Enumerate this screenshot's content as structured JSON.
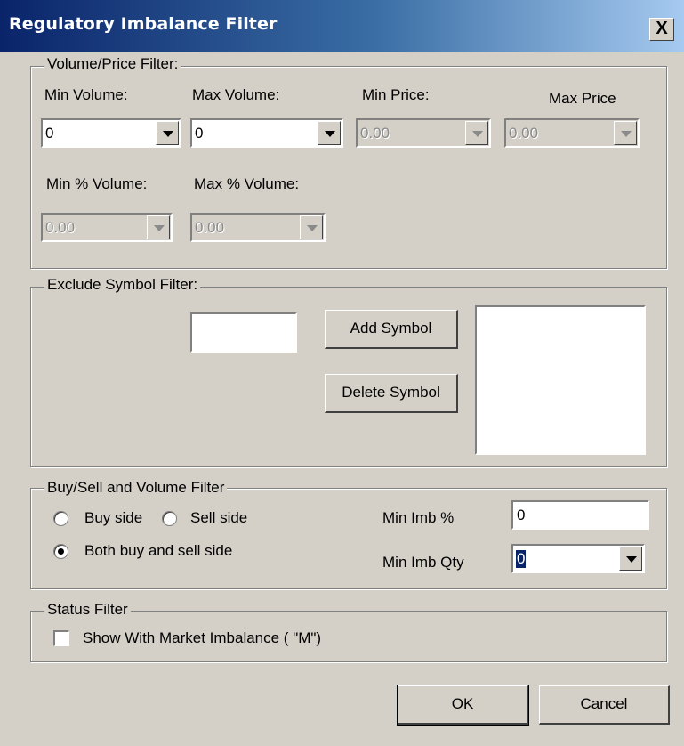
{
  "window": {
    "title": "Regulatory Imbalance Filter",
    "close_label": "X"
  },
  "volume_price": {
    "legend": "Volume/Price Filter:",
    "min_volume_label": "Min Volume:",
    "max_volume_label": "Max Volume:",
    "min_price_label": "Min Price:",
    "max_price_label": "Max Price",
    "min_pct_volume_label": "Min % Volume:",
    "max_pct_volume_label": "Max % Volume:",
    "min_volume_value": "0",
    "max_volume_value": "0",
    "min_price_value": "0.00",
    "max_price_value": "0.00",
    "min_pct_volume_value": "0.00",
    "max_pct_volume_value": "0.00"
  },
  "exclude_symbol": {
    "legend": "Exclude Symbol Filter:",
    "symbol_value": "",
    "add_label": "Add Symbol",
    "delete_label": "Delete Symbol"
  },
  "buy_sell": {
    "legend": "Buy/Sell and Volume Filter",
    "buy_side_label": "Buy side",
    "sell_side_label": "Sell side",
    "both_label": "Both buy and sell side",
    "min_imb_pct_label": "Min Imb %",
    "min_imb_pct_value": "0",
    "min_imb_qty_label": "Min Imb Qty",
    "min_imb_qty_value": "0"
  },
  "status": {
    "legend": "Status Filter",
    "market_imbalance_label": "Show With Market Imbalance ( \"M\")"
  },
  "buttons": {
    "ok_label": "OK",
    "cancel_label": "Cancel"
  },
  "colors": {
    "titlebar_start": "#0a246a",
    "titlebar_end": "#a6caf0",
    "dialog_face": "#d4d0c8"
  }
}
